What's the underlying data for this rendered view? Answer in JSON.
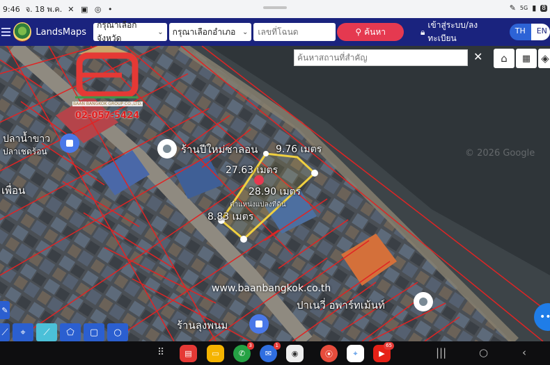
{
  "status_bar": {
    "time": "9:46",
    "date": "จ. 18 พ.ค.",
    "battery": "8",
    "signal": "5G"
  },
  "header": {
    "brand": "LandsMaps",
    "province_select": "กรุณาเลือกจังหวัด",
    "district_select": "กรุณาเลือกอำเภอ",
    "deed_placeholder": "เลขที่โฉนด",
    "search_label": "ค้นหา",
    "login_label": "เข้าสู่ระบบ/ลงทะเบียน",
    "lang_th": "TH",
    "lang_en": "EN"
  },
  "map": {
    "place_search_placeholder": "ค้นหาสถานที่สำคัญ",
    "labels": {
      "shop_top": "ร้านปีใหม่ซาลอน",
      "fish_shop": "ปลาน้ำขาว",
      "fish_sub": "ปลาเชดร้อน",
      "left_partial": "เพื่อน",
      "apartment": "ปาเนวี่ อพาร์ทเม้นท์",
      "shop_bottom": "ร้านลุงพนม"
    },
    "measurements": {
      "top_right": "9.76 เมตร",
      "top_left": "27.63 เมตร",
      "bottom_right": "28.90 เมตร",
      "bottom_left": "8.83 เมตร"
    },
    "parcel_label": "ตำแหน่งแปลงที่ดิน",
    "watermark": "www.baanbangkok.co.th",
    "google_wm": "© 2026 Google",
    "overlay_logo_subtitle": "BAAN BANGKOK GROUP CO.,LTD.",
    "overlay_phone": "02-057-5424"
  },
  "icons": {
    "menu": "hamburger-icon",
    "search": "magnifier-icon",
    "login": "lock-icon",
    "home": "home-icon",
    "grid": "grid-icon",
    "layers": "layers-icon"
  },
  "dock": {
    "whatsapp_badge": "3",
    "chat_badge": "1",
    "youtube_badge": "65"
  },
  "colors": {
    "header_bg": "#1a237e",
    "search_btn": "#e53950",
    "parcel_outline": "#f0d040",
    "lot_lines": "#e02424",
    "lang_active": "#2d63d6"
  }
}
